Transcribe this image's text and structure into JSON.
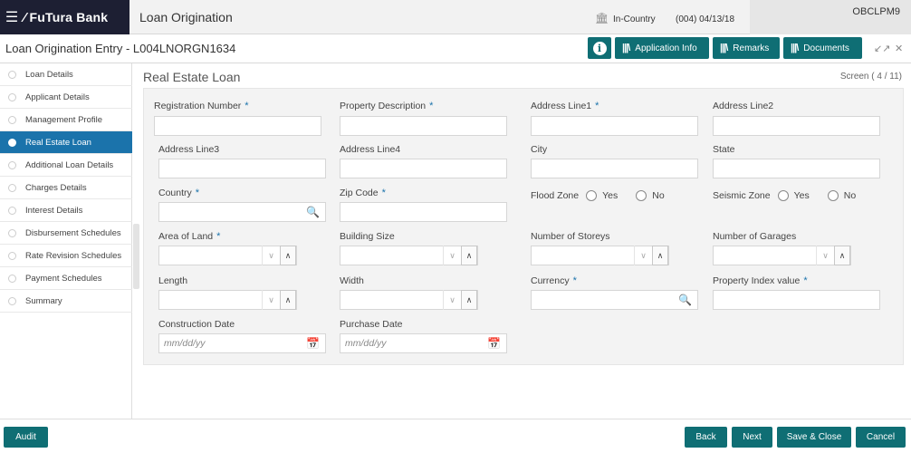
{
  "header": {
    "brand_name": "FuTura Bank",
    "app_title": "Loan Origination",
    "branch": "In-Country",
    "branch_date": "(004)  04/13/18",
    "user_id": "OBCLPM9"
  },
  "subheader": {
    "page_title": "Loan Origination Entry - L004LNORGN1634",
    "info_label": "i",
    "application_info_label": "Application Info",
    "remarks_label": "Remarks",
    "documents_label": "Documents"
  },
  "sidebar": {
    "items": [
      {
        "label": "Loan Details",
        "active": false
      },
      {
        "label": "Applicant Details",
        "active": false
      },
      {
        "label": "Management Profile",
        "active": false
      },
      {
        "label": "Real Estate Loan",
        "active": true
      },
      {
        "label": "Additional Loan Details",
        "active": false
      },
      {
        "label": "Charges Details",
        "active": false
      },
      {
        "label": "Interest Details",
        "active": false
      },
      {
        "label": "Disbursement Schedules",
        "active": false
      },
      {
        "label": "Rate Revision Schedules",
        "active": false
      },
      {
        "label": "Payment Schedules",
        "active": false
      },
      {
        "label": "Summary",
        "active": false
      }
    ]
  },
  "main": {
    "section_title": "Real Estate Loan",
    "screen_counter": "Screen ( 4 / 11)",
    "fields": {
      "registration_number": {
        "label": "Registration Number",
        "required": "*"
      },
      "property_description": {
        "label": "Property Description",
        "required": "*"
      },
      "address_line1": {
        "label": "Address Line1",
        "required": "*"
      },
      "address_line2": {
        "label": "Address Line2"
      },
      "address_line3": {
        "label": "Address Line3"
      },
      "address_line4": {
        "label": "Address Line4"
      },
      "city": {
        "label": "City"
      },
      "state": {
        "label": "State"
      },
      "country": {
        "label": "Country",
        "required": "*"
      },
      "zip_code": {
        "label": "Zip Code",
        "required": "*"
      },
      "flood_zone": {
        "label": "Flood Zone",
        "yes": "Yes",
        "no": "No"
      },
      "seismic_zone": {
        "label": "Seismic Zone",
        "yes": "Yes",
        "no": "No"
      },
      "area_of_land": {
        "label": "Area of Land",
        "required": "*"
      },
      "building_size": {
        "label": "Building Size"
      },
      "number_of_storeys": {
        "label": "Number of Storeys"
      },
      "number_of_garages": {
        "label": "Number of Garages"
      },
      "length": {
        "label": "Length"
      },
      "width": {
        "label": "Width"
      },
      "currency": {
        "label": "Currency",
        "required": "*"
      },
      "property_index_value": {
        "label": "Property Index value",
        "required": "*"
      },
      "construction_date": {
        "label": "Construction Date",
        "placeholder": "mm/dd/yy"
      },
      "purchase_date": {
        "label": "Purchase Date",
        "placeholder": "mm/dd/yy"
      }
    }
  },
  "footer": {
    "audit_label": "Audit",
    "back_label": "Back",
    "next_label": "Next",
    "save_close_label": "Save & Close",
    "cancel_label": "Cancel"
  },
  "colors": {
    "brand_bg": "#1d1f33",
    "accent_teal": "#0f6e74",
    "active_blue": "#1b73ab"
  },
  "icons": [
    "hamburger-icon",
    "logo-icon",
    "bank-branch-icon",
    "info-icon",
    "bars-icon",
    "minimize-icon",
    "close-icon",
    "search-icon",
    "calendar-icon",
    "chevron-down-icon",
    "chevron-up-icon"
  ]
}
